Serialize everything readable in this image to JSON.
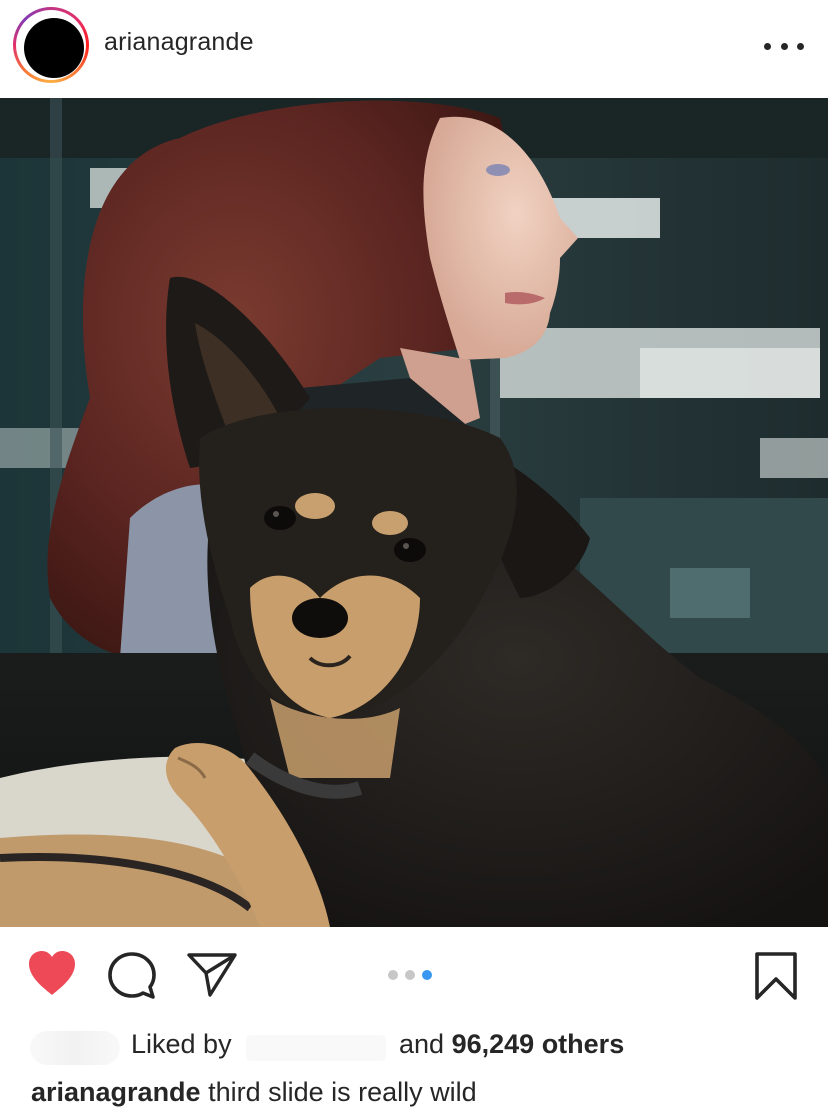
{
  "post": {
    "username": "arianagrande",
    "media": {
      "slide_count": 3,
      "active_slide": 3
    }
  },
  "actions": {
    "like_icon": "heart-filled-icon",
    "comment_icon": "comment-bubble-icon",
    "share_icon": "paper-plane-icon",
    "save_icon": "bookmark-icon",
    "liked": true
  },
  "likes": {
    "liked_by_label": "Liked by",
    "and_label": "and",
    "count": "96,249",
    "others_label": "others"
  },
  "caption": {
    "username": "arianagrande",
    "text": "third slide is really wild"
  },
  "colors": {
    "like_red": "#ed4956",
    "active_dot": "#3897f0",
    "inactive_dot": "#c7c7c7",
    "text": "#262626"
  }
}
